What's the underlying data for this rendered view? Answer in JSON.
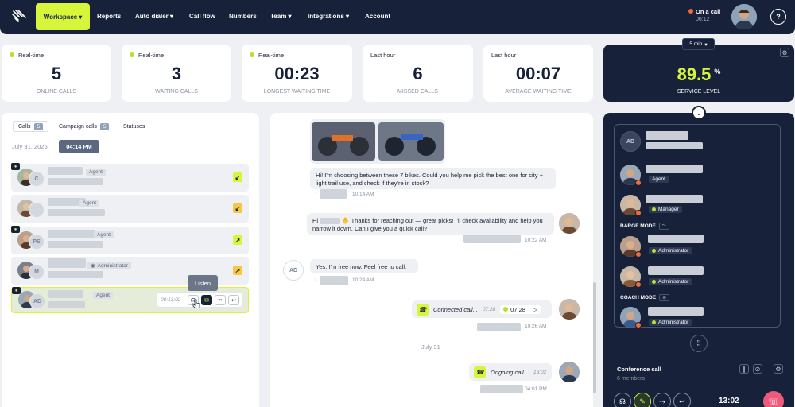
{
  "nav": {
    "workspace": "Workspace",
    "items": [
      "Reports",
      "Auto dialer",
      "Call flow",
      "Numbers",
      "Team",
      "Integrations",
      "Account"
    ],
    "status": "On a call",
    "status_time": "06:12",
    "help_icon": "?"
  },
  "stats": [
    {
      "label": "Real-time",
      "value": "5",
      "caption": "ONLINE CALLS"
    },
    {
      "label": "Real-time",
      "value": "3",
      "caption": "WAITING CALLS"
    },
    {
      "label": "Real-time",
      "value": "00:23",
      "caption": "LONGEST WAITING TIME"
    },
    {
      "label": "Last hour",
      "value": "6",
      "caption": "MISSED CALLS"
    },
    {
      "label": "Last hour",
      "value": "00:07",
      "caption": "AVERAGE WAITING TIME"
    }
  ],
  "service": {
    "interval": "5 min",
    "value": "89.5",
    "unit": "%",
    "caption": "SERVICE LEVEL"
  },
  "tabs": [
    {
      "label": "Calls",
      "count": "5"
    },
    {
      "label": "Campaign calls",
      "count": "5"
    },
    {
      "label": "Statuses",
      "count": ""
    }
  ],
  "date": "July 31, 2025",
  "time_chip": "04:14 PM",
  "calls": [
    {
      "initials": "C",
      "role": "Agent"
    },
    {
      "initials": "",
      "role": "Agent"
    },
    {
      "initials": "PS",
      "role": "Agent"
    },
    {
      "initials": "M",
      "role": "Administrator"
    },
    {
      "initials": "AD",
      "role": "Agent",
      "timer": "00:13:02"
    }
  ],
  "tooltip": "Listen",
  "chat": {
    "m1": "Hi! I'm choosing between these 7 bikes. Could you help me pick the best one for city + light trail use, and check if they're in stock?",
    "m1_time": "10:14 AM",
    "m2": "Thanks for reaching out — great picks! I'll check availability and help you narrow it down. Can I give you a quick call?",
    "m2_prefix": "Hi",
    "m2_time": "10:22 AM",
    "m3": "Yes, I'm free now. Feel free to call.",
    "m3_time": "10:24 AM",
    "ad": "AD",
    "call1": "Connected call...",
    "call1_t1": "07:28",
    "call1_t2": "07:28",
    "call1_time": "10:26 AM",
    "divider": "July 31",
    "call2": "Ongoing call...",
    "call2_t": "13:02",
    "call2_time": "04:01 PM"
  },
  "right": {
    "ad": "AD",
    "p1_role": "Agent",
    "p2_role": "Manager",
    "barge": "BARGE MODE",
    "p3_role": "Administrator",
    "p4_role": "Administrator",
    "coach": "COACH MODE",
    "p5_role": "Administrator",
    "conf": "Conference call",
    "members": "6 members",
    "timer": "13:02"
  }
}
